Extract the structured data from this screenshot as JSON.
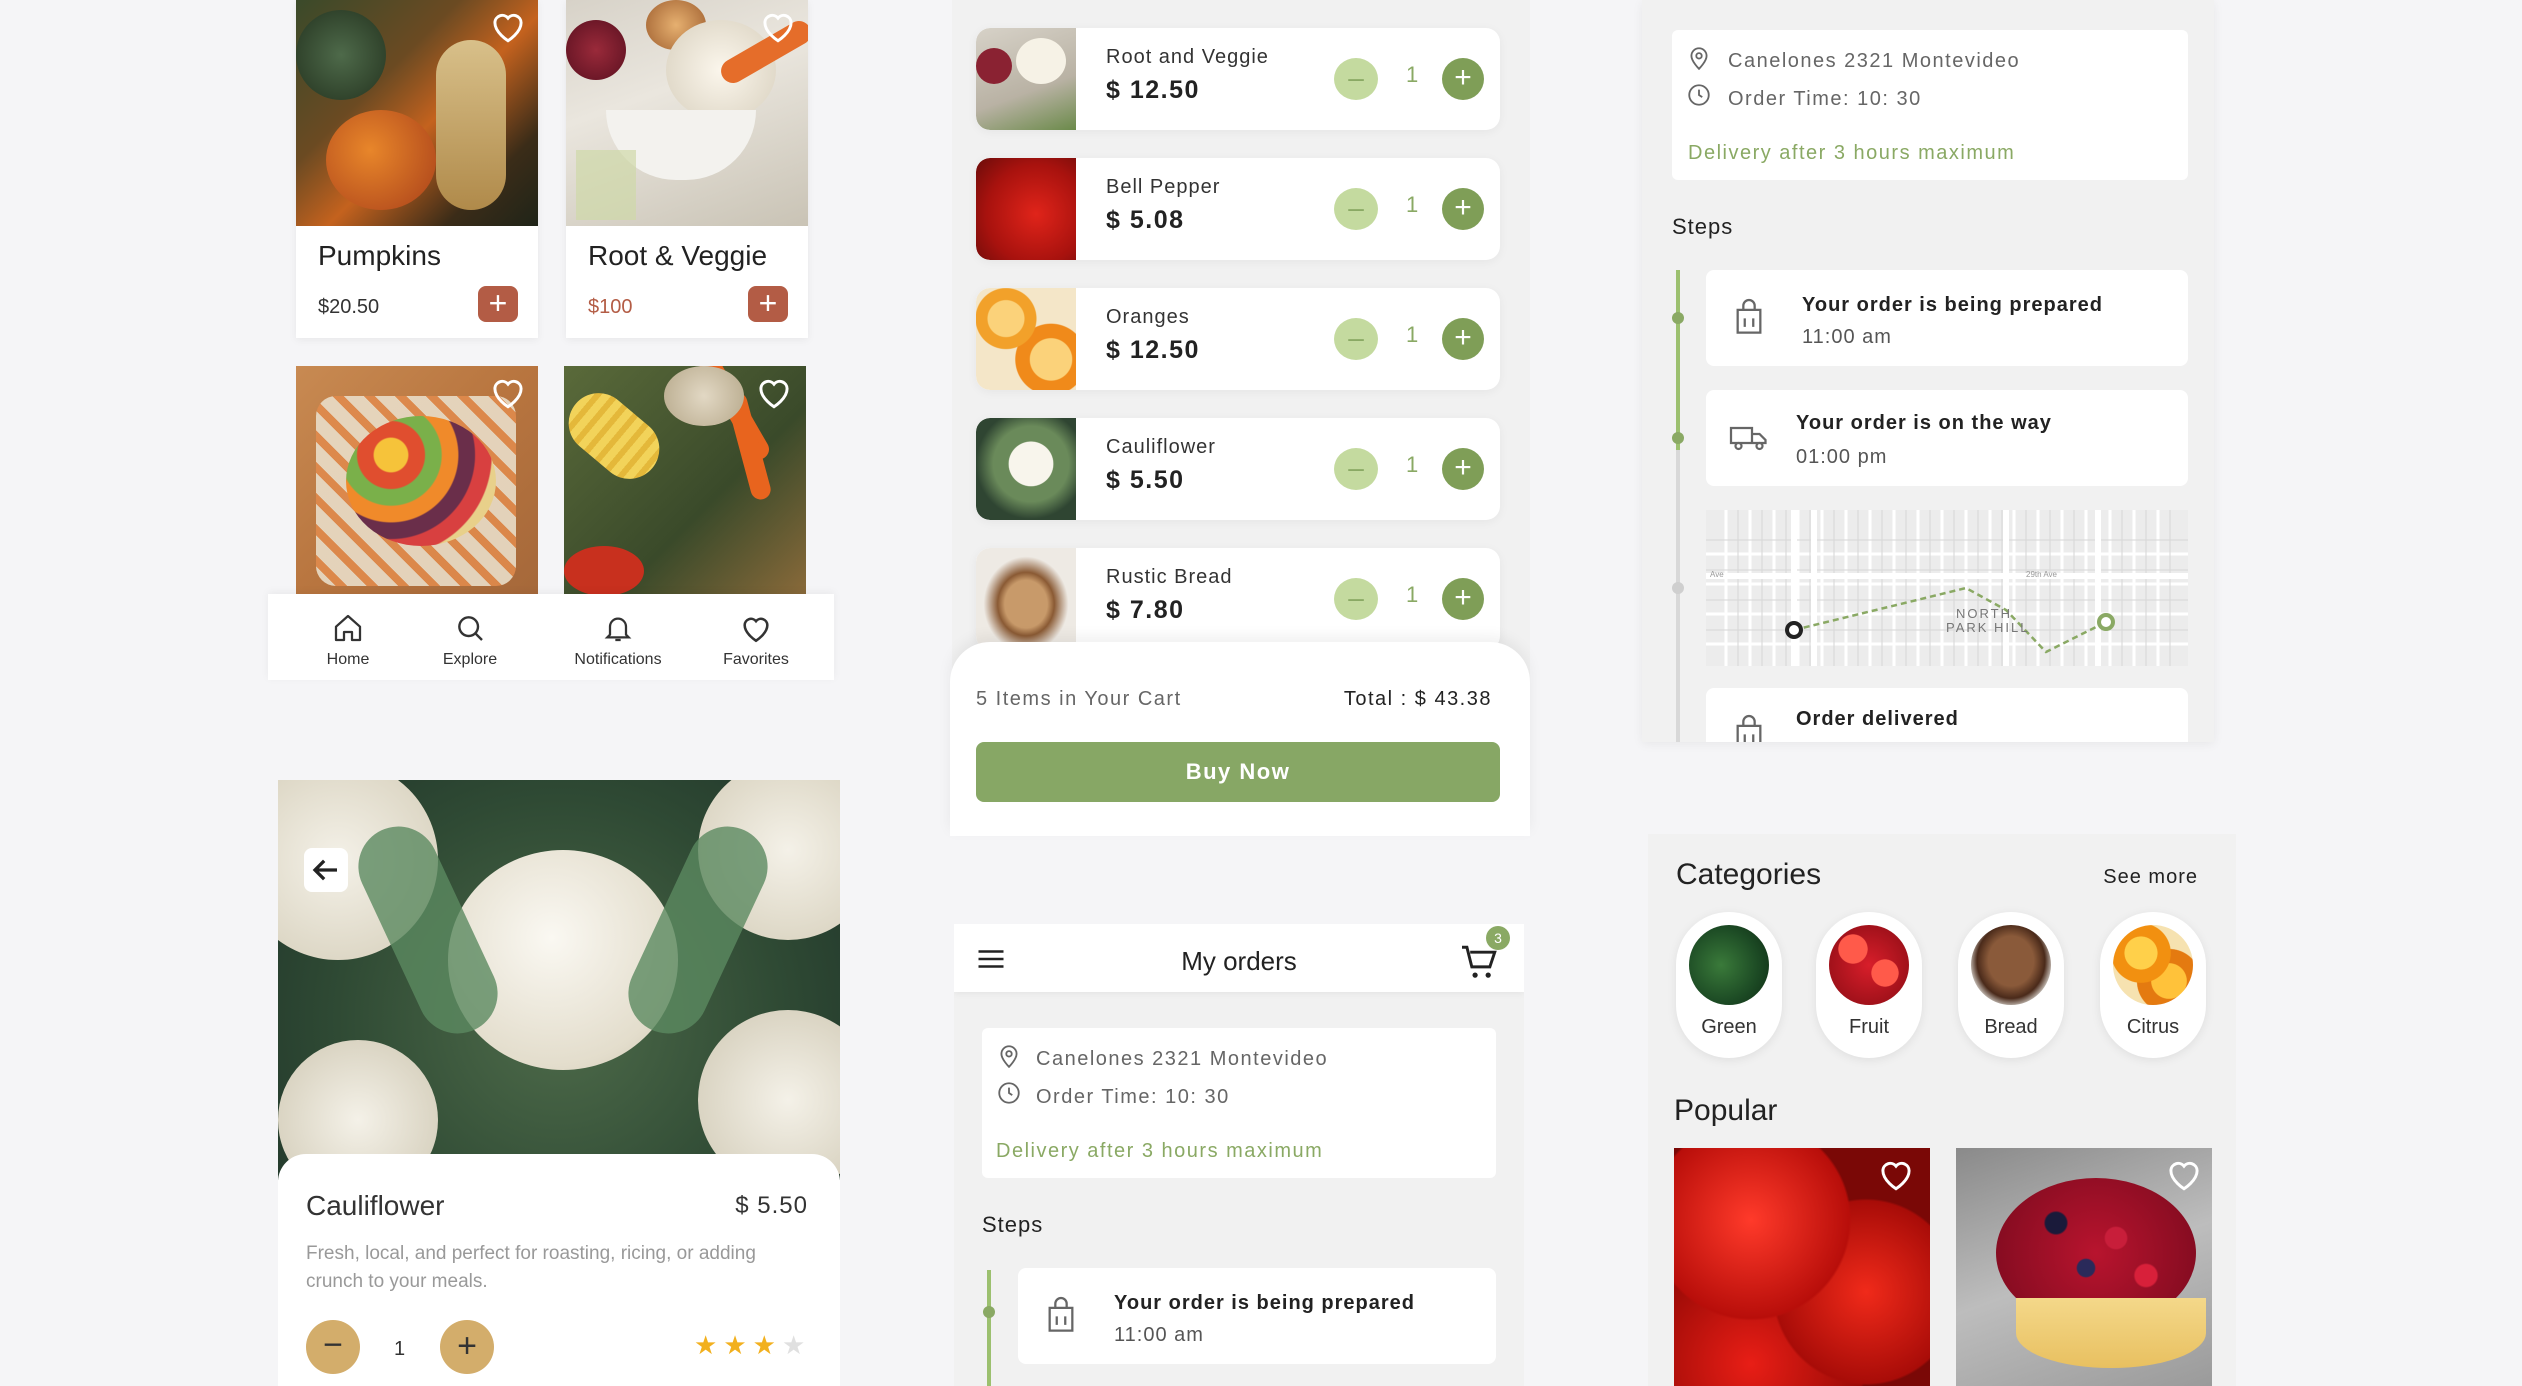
{
  "products": [
    {
      "name": "Pumpkins",
      "price": "$20.50"
    },
    {
      "name": "Root & Veggie",
      "price": "$100"
    }
  ],
  "nav": {
    "home": "Home",
    "explore": "Explore",
    "notifications": "Notifications",
    "favorites": "Favorites"
  },
  "detail": {
    "name": "Cauliflower",
    "price": "$ 5.50",
    "description": "Fresh, local, and perfect for roasting, ricing, or adding crunch to your meals.",
    "quantity": "1",
    "rating": 3,
    "rating_max": 4
  },
  "cart": {
    "items": [
      {
        "name": "Root and Veggie",
        "price": "$ 12.50",
        "qty": "1"
      },
      {
        "name": "Bell Pepper",
        "price": "$ 5.08",
        "qty": "1"
      },
      {
        "name": "Oranges",
        "price": "$ 12.50",
        "qty": "1"
      },
      {
        "name": "Cauliflower",
        "price": "$ 5.50",
        "qty": "1"
      },
      {
        "name": "Rustic Bread",
        "price": "$ 7.80",
        "qty": "1"
      }
    ],
    "count_text": "5 Items in Your Cart",
    "total_text": "Total : $ 43.38",
    "buy_label": "Buy Now",
    "minus": "–",
    "plus": "+"
  },
  "orders": {
    "title": "My orders",
    "cart_badge": "3",
    "address": "Canelones 2321 Montevideo",
    "order_time": "Order Time: 10: 30",
    "delivery_note": "Delivery after 3 hours maximum",
    "steps_title": "Steps",
    "step1_title": "Your order is being prepared",
    "step1_time": "11:00 am",
    "step2_title": "Your order is on the way",
    "step2_time": "01:00 pm",
    "step3_title": "Order delivered",
    "map_label1": "NORTH",
    "map_label2": "PARK HILL",
    "map_street": "29th Ave",
    "map_ave": "Ave"
  },
  "categories": {
    "title": "Categories",
    "see_more": "See more",
    "items": [
      {
        "label": "Green"
      },
      {
        "label": "Fruit"
      },
      {
        "label": "Bread"
      },
      {
        "label": "Citrus"
      }
    ],
    "popular_title": "Popular"
  },
  "colors": {
    "accent": "#7f9e57",
    "accent_light": "#c4da9f",
    "brand_red": "#b35c45",
    "gold": "#d3ad6b",
    "star": "#f2b01e"
  }
}
